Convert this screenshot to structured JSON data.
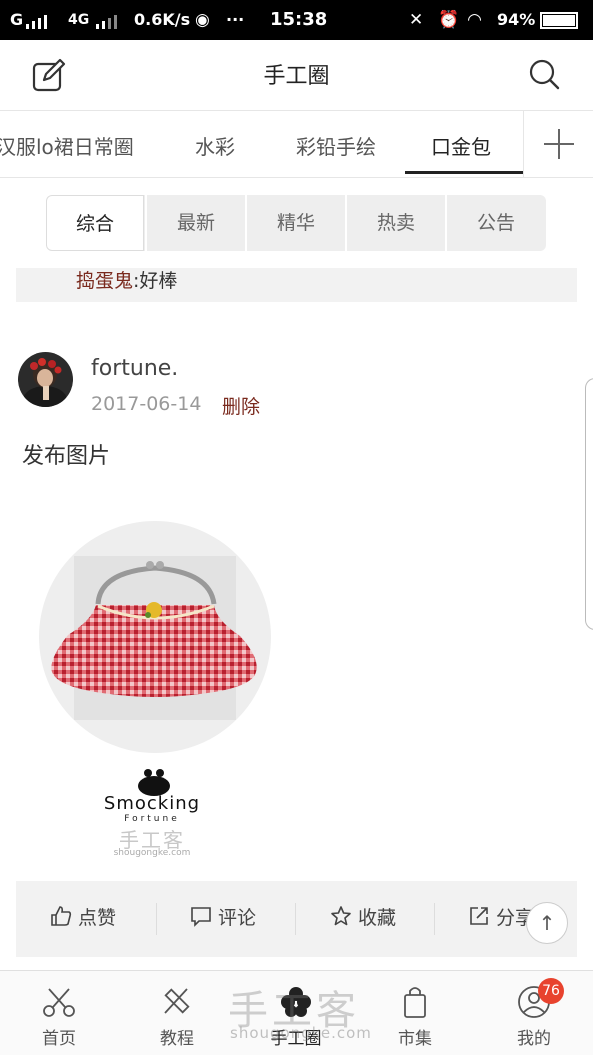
{
  "status_bar": {
    "carrier1": "G",
    "carrier2": "4G",
    "speed": "0.6K/s",
    "more": "···",
    "time": "15:38",
    "battery": "94%"
  },
  "header": {
    "title": "手工圈"
  },
  "category_tabs": [
    "汉服lo裙日常圈",
    "水彩",
    "彩铅手绘",
    "口金包"
  ],
  "filter_tabs": [
    "综合",
    "最新",
    "精华",
    "热卖",
    "公告"
  ],
  "previous_comment": {
    "author": "捣蛋鬼",
    "separator": ":",
    "text": "好棒"
  },
  "post": {
    "username": "fortune.",
    "date": "2017-06-14",
    "delete_label": "删除",
    "text": "发布图片",
    "image": {
      "brand": "Smocking",
      "brand_sub": "Fortune",
      "watermark": "手工客",
      "watermark_url": "shougongke.com"
    }
  },
  "actions": {
    "like": "点赞",
    "comment": "评论",
    "favorite": "收藏",
    "share": "分享"
  },
  "bottom_nav": [
    "首页",
    "教程",
    "手工圈",
    "市集",
    "我的"
  ],
  "notification_badge": "76",
  "watermark": {
    "text": "手工客",
    "url": "shougongke.com"
  },
  "colors": {
    "accent_link": "#7a2a1e",
    "badge": "#e8432e"
  }
}
